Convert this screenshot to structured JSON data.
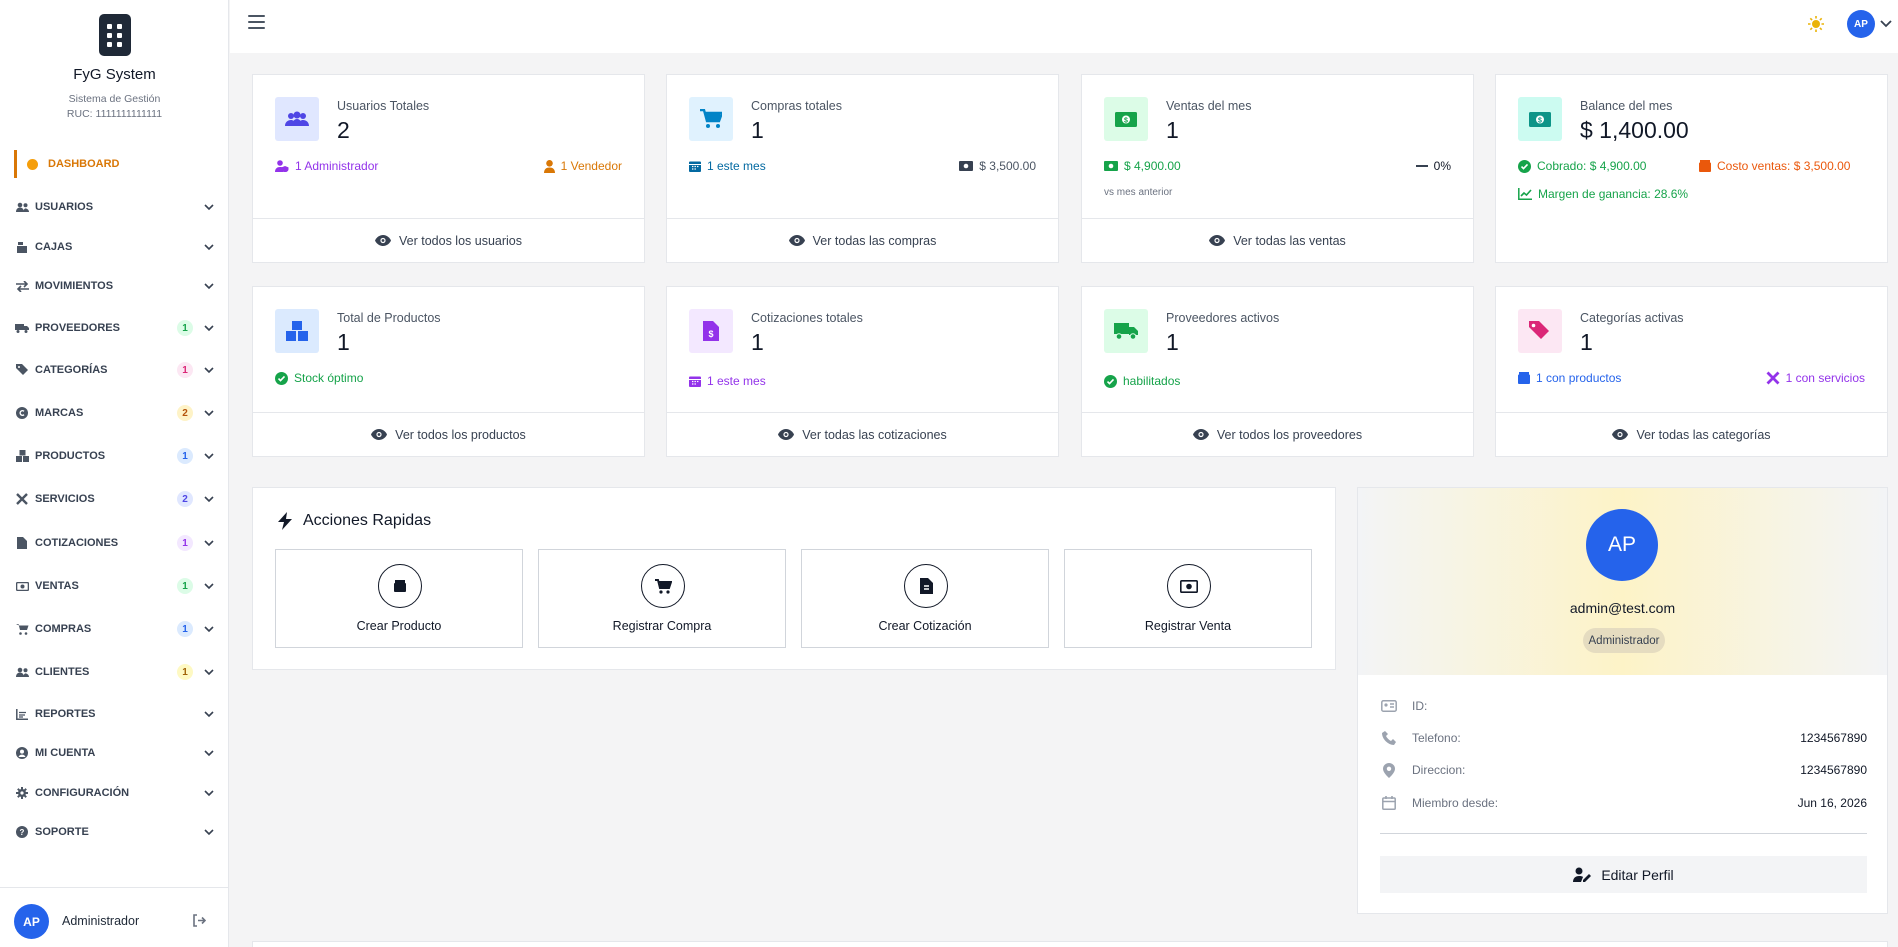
{
  "app": {
    "brand": "FyG System",
    "subtitle": "Sistema de Gestión",
    "ruc": "RUC: 1111111111111"
  },
  "sidebar": {
    "active": "DASHBOARD",
    "items": [
      {
        "label": "USUARIOS",
        "icon": "users-icon",
        "badge": null
      },
      {
        "label": "CAJAS",
        "icon": "cash-register-icon",
        "badge": null
      },
      {
        "label": "MOVIMIENTOS",
        "icon": "exchange-icon",
        "badge": null
      },
      {
        "label": "PROVEEDORES",
        "icon": "truck-icon",
        "badge": "1",
        "badge_bg": "#dcfce7",
        "badge_fg": "#16a34a"
      },
      {
        "label": "CATEGORÍAS",
        "icon": "tags-icon",
        "badge": "1",
        "badge_bg": "#fce7f3",
        "badge_fg": "#db2777"
      },
      {
        "label": "MARCAS",
        "icon": "copyright-icon",
        "badge": "2",
        "badge_bg": "#fef3c7",
        "badge_fg": "#b45309"
      },
      {
        "label": "PRODUCTOS",
        "icon": "boxes-icon",
        "badge": "1",
        "badge_bg": "#dbeafe",
        "badge_fg": "#2563eb"
      },
      {
        "label": "SERVICIOS",
        "icon": "tools-icon",
        "badge": "2",
        "badge_bg": "#e0e7ff",
        "badge_fg": "#4f46e5"
      },
      {
        "label": "COTIZACIONES",
        "icon": "file-icon",
        "badge": "1",
        "badge_bg": "#f3e8ff",
        "badge_fg": "#9333ea"
      },
      {
        "label": "VENTAS",
        "icon": "money-icon",
        "badge": "1",
        "badge_bg": "#dcfce7",
        "badge_fg": "#16a34a"
      },
      {
        "label": "COMPRAS",
        "icon": "cart-icon",
        "badge": "1",
        "badge_bg": "#dbeafe",
        "badge_fg": "#2563eb"
      },
      {
        "label": "CLIENTES",
        "icon": "user-group-icon",
        "badge": "1",
        "badge_bg": "#fef9c3",
        "badge_fg": "#a16207"
      },
      {
        "label": "REPORTES",
        "icon": "chart-icon",
        "badge": null
      },
      {
        "label": "MI CUENTA",
        "icon": "user-circle-icon",
        "badge": null
      },
      {
        "label": "CONFIGURACIÓN",
        "icon": "gear-icon",
        "badge": null
      },
      {
        "label": "SOPORTE",
        "icon": "question-icon",
        "badge": null
      }
    ],
    "footer": {
      "avatar": "AP",
      "name": "Administrador"
    }
  },
  "topbar": {
    "avatar": "AP"
  },
  "cards": [
    {
      "title": "Usuarios Totales",
      "value": "2",
      "icon_bg": "#e0e7ff",
      "icon_color": "#4f46e5",
      "meta_left": "1 Administrador",
      "meta_left_color": "#9333ea",
      "meta_right": "1 Vendedor",
      "meta_right_color": "#d97706",
      "footer": "Ver todos los usuarios"
    },
    {
      "title": "Compras totales",
      "value": "1",
      "icon_bg": "#e0f2fe",
      "icon_color": "#0284c7",
      "meta_left": "1 este mes",
      "meta_left_color": "#0369a1",
      "meta_right": "$ 3,500.00",
      "meta_right_color": "#4b5563",
      "footer": "Ver todas las compras"
    },
    {
      "title": "Ventas del mes",
      "value": "1",
      "icon_bg": "#dcfce7",
      "icon_color": "#16a34a",
      "meta_left": "$ 4,900.00",
      "meta_left_color": "#16a34a",
      "meta_right": "0%",
      "meta_right_color": "#111827",
      "note": "vs mes anterior",
      "footer": "Ver todas las ventas"
    },
    {
      "title": "Balance del mes",
      "value": "$ 1,400.00",
      "icon_bg": "#ccfbf1",
      "icon_color": "#0d9488",
      "meta_left": "Cobrado: $ 4,900.00",
      "meta_left_color": "#16a34a",
      "meta_right": "Costo ventas: $ 3,500.00",
      "meta_right_color": "#ea580c",
      "meta_extra": "Margen de ganancia: 28.6%",
      "meta_extra_color": "#16a34a"
    },
    {
      "title": "Total de Productos",
      "value": "1",
      "icon_bg": "#dbeafe",
      "icon_color": "#2563eb",
      "meta_left": "Stock óptimo",
      "meta_left_color": "#16a34a",
      "footer": "Ver todos los productos"
    },
    {
      "title": "Cotizaciones totales",
      "value": "1",
      "icon_bg": "#f3e8ff",
      "icon_color": "#9333ea",
      "meta_left": "1 este mes",
      "meta_left_color": "#9333ea",
      "footer": "Ver todas las cotizaciones"
    },
    {
      "title": "Proveedores activos",
      "value": "1",
      "icon_bg": "#dcfce7",
      "icon_color": "#16a34a",
      "meta_left": "habilitados",
      "meta_left_color": "#16a34a",
      "footer": "Ver todos los proveedores"
    },
    {
      "title": "Categorías activas",
      "value": "1",
      "icon_bg": "#fce7f3",
      "icon_color": "#db2777",
      "meta_left": "1 con productos",
      "meta_left_color": "#2563eb",
      "meta_right": "1 con servicios",
      "meta_right_color": "#9333ea",
      "footer": "Ver todas las categorías"
    }
  ],
  "quick_actions": {
    "title": "Acciones Rapidas",
    "buttons": [
      {
        "label": "Crear Producto",
        "icon": "box-icon"
      },
      {
        "label": "Registrar Compra",
        "icon": "cart-icon"
      },
      {
        "label": "Crear Cotización",
        "icon": "file-invoice-icon"
      },
      {
        "label": "Registrar Venta",
        "icon": "money-bill-icon"
      }
    ]
  },
  "profile": {
    "avatar": "AP",
    "email": "admin@test.com",
    "role": "Administrador",
    "rows": [
      {
        "key": "ID:",
        "value": "",
        "icon": "id-card-icon"
      },
      {
        "key": "Telefono:",
        "value": "1234567890",
        "icon": "phone-icon"
      },
      {
        "key": "Direccion:",
        "value": "1234567890",
        "icon": "map-pin-icon"
      },
      {
        "key": "Miembro desde:",
        "value": "Jun 16, 2026",
        "icon": "calendar-icon"
      }
    ],
    "edit_label": "Editar Perfil"
  },
  "colors": {
    "accent": "#d97706",
    "primary": "#2563eb"
  }
}
